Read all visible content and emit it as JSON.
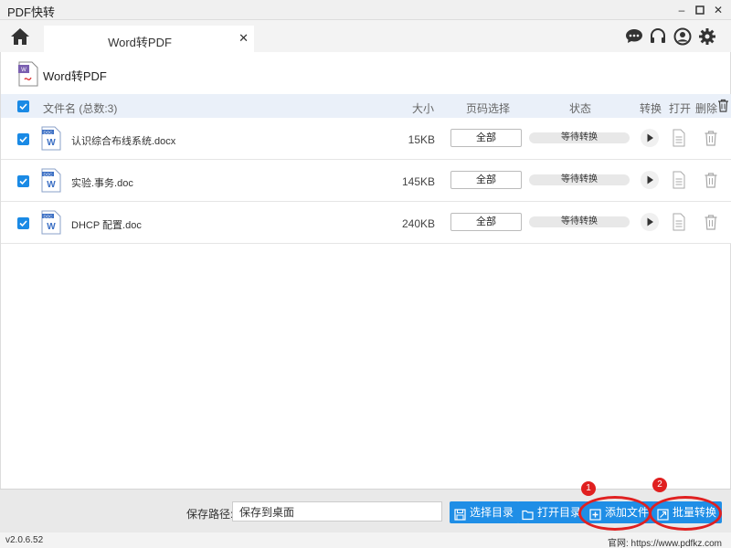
{
  "app": {
    "title": "PDF快转",
    "window_controls": [
      "minimize-icon",
      "maximize-icon",
      "close-icon"
    ]
  },
  "tabs": [
    {
      "label": "Word转PDF",
      "close": "✕"
    }
  ],
  "toolbar_icons": [
    "chat-icon",
    "headset-icon",
    "user-icon",
    "gear-icon"
  ],
  "page": {
    "title": "Word转PDF"
  },
  "table": {
    "headers": {
      "filename": "文件名 (总数:3)",
      "size": "大小",
      "page_select": "页码选择",
      "status": "状态",
      "convert": "转换",
      "open": "打开",
      "delete": "删除"
    },
    "rows": [
      {
        "name": "认识综合布线系统.docx",
        "size": "15KB",
        "pages": "全部",
        "status": "等待转换",
        "checked": true
      },
      {
        "name": "实验.事务.doc",
        "size": "145KB",
        "pages": "全部",
        "status": "等待转换",
        "checked": true
      },
      {
        "name": "DHCP 配置.doc",
        "size": "240KB",
        "pages": "全部",
        "status": "等待转换",
        "checked": true
      }
    ]
  },
  "bottom": {
    "save_label": "保存路径:",
    "save_value": "保存到桌面",
    "choose_dir": "选择目录",
    "open_dir": "打开目录",
    "add_file": "添加文件",
    "batch_convert": "批量转换",
    "badge_1": "1",
    "badge_2": "2"
  },
  "statusbar": {
    "version": "v2.0.6.52",
    "site": "官网: https://www.pdfkz.com"
  },
  "colors": {
    "accent": "#1f8ee6",
    "checkbox": "#1a8ae5",
    "highlight": "#e02020",
    "header_bg": "#eaf0f9"
  }
}
